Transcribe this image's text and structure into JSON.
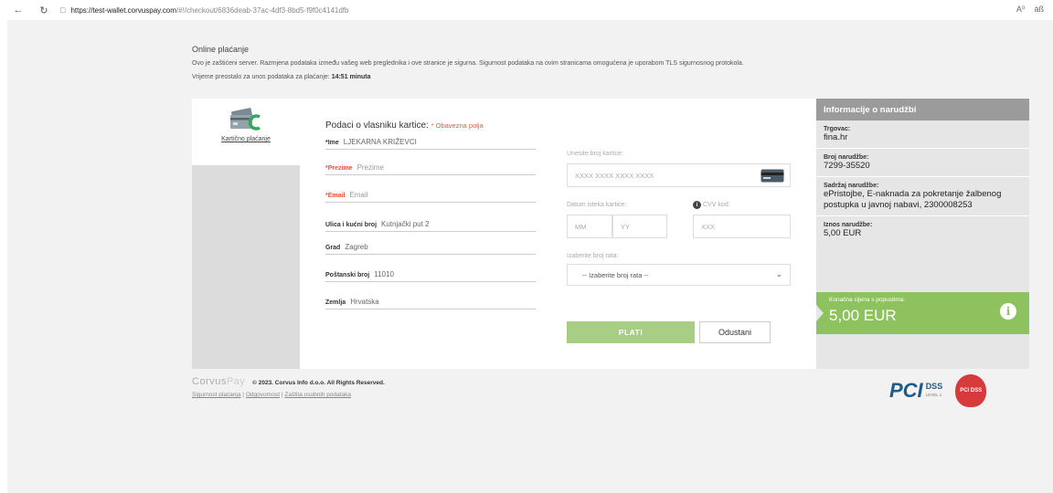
{
  "browser": {
    "url_host": "https://test-wallet.corvuspay.com",
    "url_path": "/#!/checkout/6836deab-37ac-4df3-8bd5-f9f0c4141dfb",
    "reader_label": "A⁰",
    "extra_label": "àß"
  },
  "intro": {
    "title": "Online plaćanje",
    "line1": "Ovo je zaštićeni server. Razmjena podataka između vašeg web preglednika i ove stranice je sigurna. Sigurnost podataka na ovim stranicama omogućena je uporabom TLS sigurnosnog protokola.",
    "time_label": "Vrijeme preostalo za unos podataka za plaćanje:",
    "time_value": "14:51 minuta"
  },
  "payment_method": {
    "label": "Kartično plaćanje"
  },
  "owner": {
    "heading": "Podaci o vlasniku kartice:",
    "required": "* Obavezna polja",
    "fields": {
      "ime": {
        "label": "*Ime",
        "value": "LJEKARNA KRIŽEVCI"
      },
      "prezime": {
        "label": "*Prezime",
        "placeholder": "Prezime"
      },
      "email": {
        "label": "*Email",
        "placeholder": "Email"
      },
      "ulica": {
        "label": "Ulica i kućni broj",
        "value": "Kutnjački put 2"
      },
      "grad": {
        "label": "Grad",
        "value": "Zagreb"
      },
      "postanski": {
        "label": "Poštanski broj",
        "value": "11010"
      },
      "zemlja": {
        "label": "Zemlja",
        "value": "Hrvatska"
      }
    }
  },
  "card": {
    "number_label": "Unesite broj kartice:",
    "number_placeholder": "XXXX XXXX XXXX XXXX",
    "expiry_label": "Datum isteka kartice:",
    "month_placeholder": "MM",
    "year_placeholder": "YY",
    "cvv_label": "CVV kod:",
    "cvv_placeholder": "XXX",
    "installments_label": "Izaberite broj rata:",
    "installments_selected": "-- Izaberite broj rata --"
  },
  "actions": {
    "pay": "PLATI",
    "cancel": "Odustani"
  },
  "order": {
    "heading": "Informacije o narudžbi",
    "merchant_label": "Trgovac:",
    "merchant_value": "fina.hr",
    "number_label": "Broj narudžbe:",
    "number_value": "7299-35520",
    "content_label": "Sadržaj narudžbe:",
    "content_value": "ePristojbe, E-naknada za pokretanje žalbenog postupka u javnoj nabavi, 2300008253",
    "amount_label": "Iznos narudžbe:",
    "amount_value": "5,00 EUR",
    "final_label": "Konačna cijena s popustima:",
    "final_value": "5,00 EUR"
  },
  "footer": {
    "brand_corvus": "Corvus",
    "brand_pay": "Pay",
    "copyright": "© 2023. Corvus Info d.o.o. All Rights Reserved.",
    "link_security": "Sigurnost plaćanja",
    "link_liability": "Odgovornost",
    "link_privacy": "Zaštita osobnih podataka",
    "sep": "|",
    "pci_pc": "PCI",
    "pci_dss": "DSS",
    "pci_level": "LEVEL 1",
    "pci_shield": "PCI DSS"
  },
  "colors": {
    "accent_green": "#8ec25f",
    "button_green": "#a8cd85",
    "required_red": "#e8563f",
    "header_gray": "#9b9b9b"
  }
}
